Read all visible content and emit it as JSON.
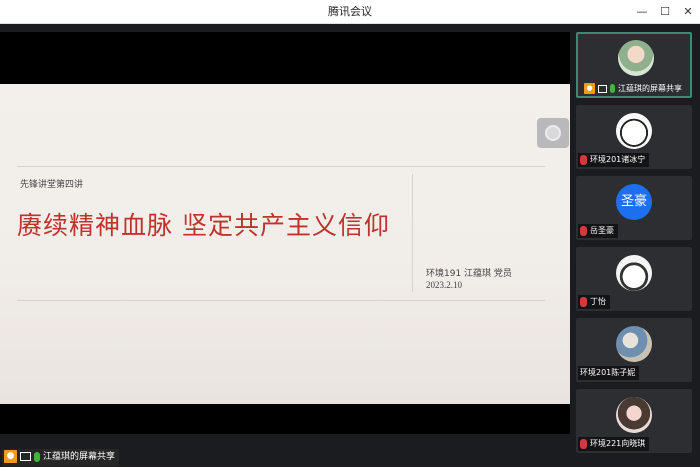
{
  "window": {
    "title": "腾讯会议",
    "minimize": "—",
    "maximize": "☐",
    "close": "✕"
  },
  "slide": {
    "series": "先锋讲堂第四讲",
    "headline": "赓续精神血脉 坚定共产主义信仰",
    "author": "环境191 江蕴琪 党员",
    "date": "2023.2.10"
  },
  "share_bar": {
    "label": "江蕴琪的屏幕共享"
  },
  "participants": [
    {
      "name": "江蕴琪的屏幕共享",
      "avatar_text": "",
      "active": true
    },
    {
      "name": "环境201诸冰宁",
      "avatar_text": "",
      "active": false
    },
    {
      "name": "岳圣豪",
      "avatar_text": "圣豪",
      "active": false
    },
    {
      "name": "丁怡",
      "avatar_text": "",
      "active": false
    },
    {
      "name": "环境201陈子妮",
      "avatar_text": "",
      "active": false
    },
    {
      "name": "环境221向晓琪",
      "avatar_text": "",
      "active": false
    }
  ],
  "colors": {
    "headline": "#c0332c",
    "accent_green": "#3fb73b",
    "avatar_blue": "#1e6ff0",
    "active_border": "#3a8b74"
  }
}
